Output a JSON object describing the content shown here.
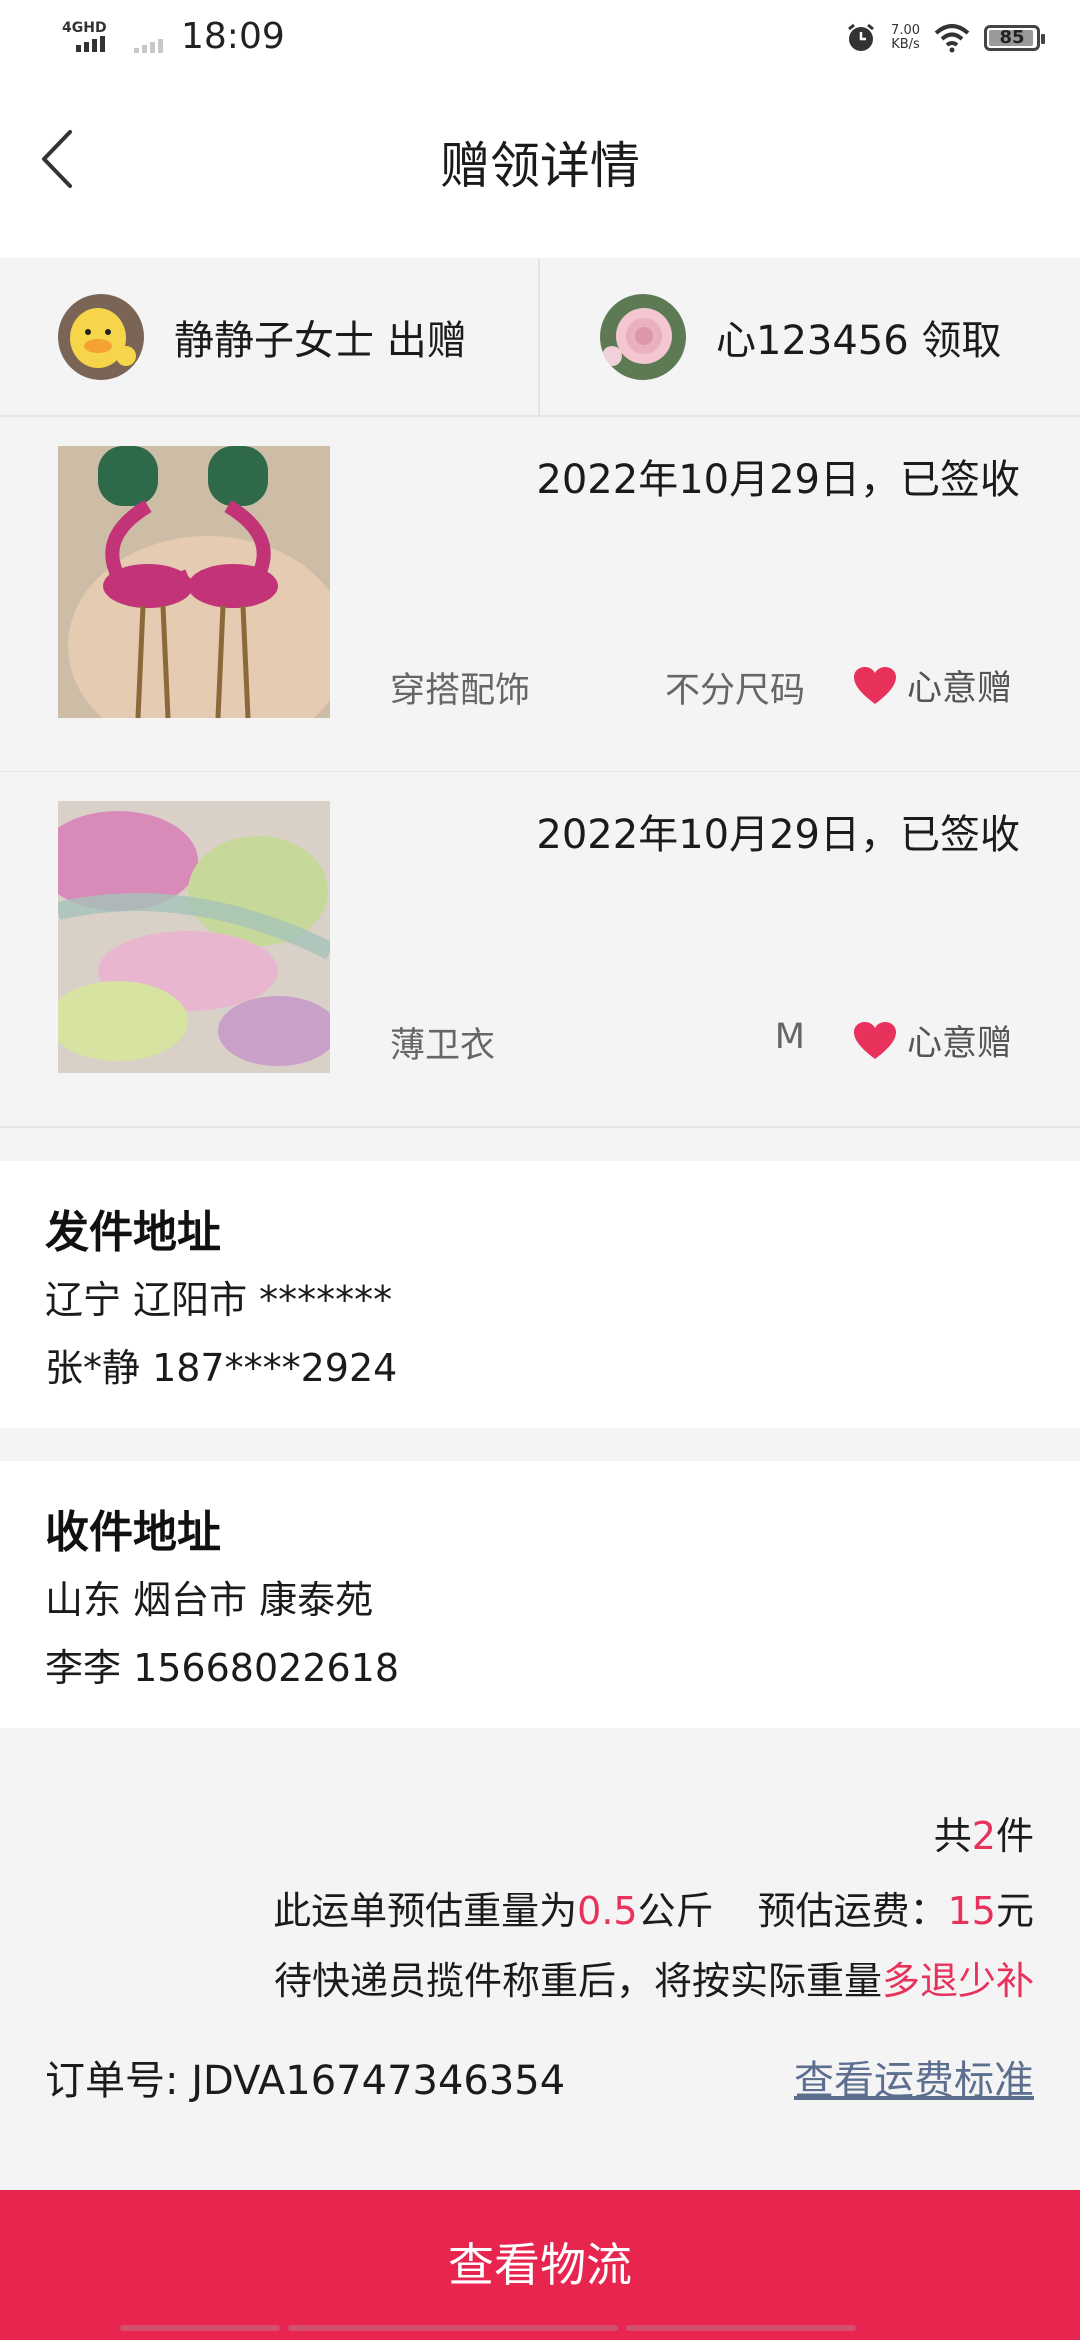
{
  "status_bar": {
    "network": "4GHD",
    "time": "18:09",
    "speed_value": "7.00",
    "speed_unit": "KB/s",
    "battery": "85"
  },
  "header": {
    "title": "赠领详情"
  },
  "parties": {
    "giver": "静静子女士 出赠",
    "receiver": "心123456 领取"
  },
  "items": [
    {
      "status": "2022年10月29日，已签收",
      "category": "穿搭配饰",
      "size": "不分尺码",
      "gift_type": "心意赠"
    },
    {
      "status": "2022年10月29日，已签收",
      "category": "薄卫衣",
      "size": "M",
      "gift_type": "心意赠"
    }
  ],
  "sender": {
    "heading": "发件地址",
    "address": "辽宁 辽阳市 *******",
    "contact": "张*静 187****2924"
  },
  "receiver": {
    "heading": "收件地址",
    "address": "山东 烟台市 康泰苑",
    "contact": "李李 15668022618"
  },
  "summary": {
    "count_prefix": "共",
    "count": "2",
    "count_suffix": "件",
    "weight_prefix": "此运单预估重量为",
    "weight": "0.5",
    "weight_unit": "公斤",
    "fee_label": "预估运费：",
    "fee": "15",
    "fee_unit": "元",
    "note": "待快递员揽件称重后，将按实际重量",
    "note_highlight": "多退少补",
    "order_label": "订单号:",
    "order_no": "JDVA16747346354",
    "fee_link": "查看运费标准"
  },
  "actions": {
    "logistics": "查看物流"
  },
  "colors": {
    "accent": "#e8254f",
    "highlight": "#e8315b",
    "link": "#5d6f8f"
  }
}
